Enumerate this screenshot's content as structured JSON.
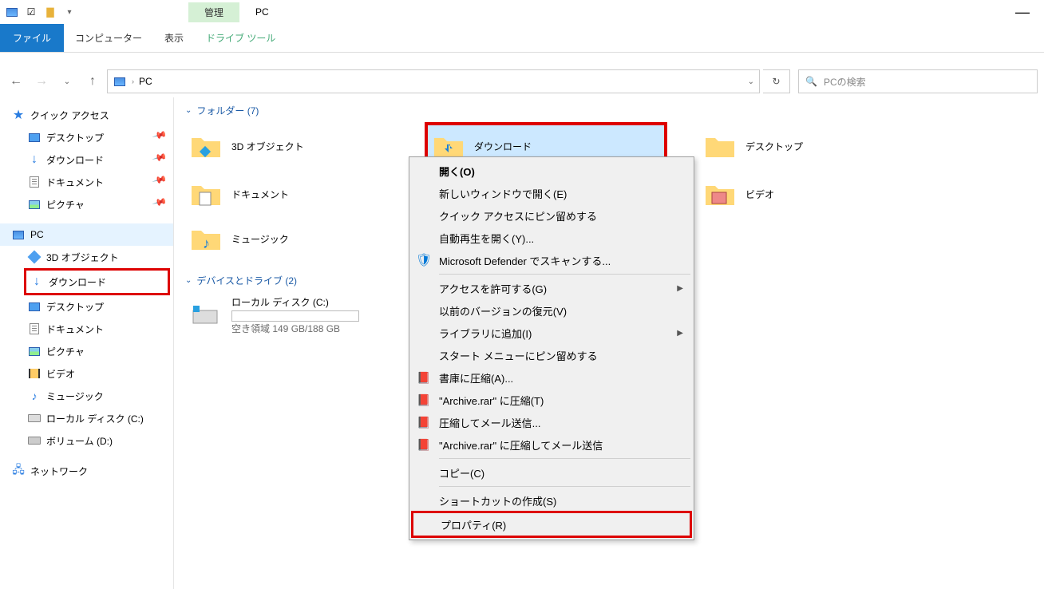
{
  "title": {
    "context_tab": "管理",
    "window_title": "PC"
  },
  "ribbon": {
    "file": "ファイル",
    "computer": "コンピューター",
    "view": "表示",
    "drive_tools": "ドライブ ツール"
  },
  "address": {
    "crumb1": "PC",
    "search_placeholder": "PCの検索"
  },
  "sidebar": {
    "quick_access": "クイック アクセス",
    "qa": {
      "desktop": "デスクトップ",
      "downloads": "ダウンロード",
      "documents": "ドキュメント",
      "pictures": "ピクチャ"
    },
    "pc": "PC",
    "pc_children": {
      "objects3d": "3D オブジェクト",
      "downloads": "ダウンロード",
      "desktop": "デスクトップ",
      "documents": "ドキュメント",
      "pictures": "ピクチャ",
      "videos": "ビデオ",
      "music": "ミュージック",
      "local_disk": "ローカル ディスク (C:)",
      "volume": "ボリューム (D:)"
    },
    "network": "ネットワーク"
  },
  "content": {
    "folders_header": "フォルダー (7)",
    "items": {
      "objects3d": "3D オブジェクト",
      "downloads": "ダウンロード",
      "desktop": "デスクトップ",
      "documents": "ドキュメント",
      "videos": "ビデオ",
      "music": "ミュージック"
    },
    "drives_header": "デバイスとドライブ (2)",
    "drive": {
      "name": "ローカル ディスク (C:)",
      "free": "空き領域 149 GB/188 GB"
    }
  },
  "context_menu": {
    "open": "開く(O)",
    "open_new_window": "新しいウィンドウで開く(E)",
    "pin_quick_access": "クイック アクセスにピン留めする",
    "autoplay": "自動再生を開く(Y)...",
    "defender": "Microsoft Defender でスキャンする...",
    "give_access": "アクセスを許可する(G)",
    "restore_previous": "以前のバージョンの復元(V)",
    "include_library": "ライブラリに追加(I)",
    "pin_start": "スタート メニューにピン留めする",
    "archive_a": "書庫に圧縮(A)...",
    "archive_rar": "\"Archive.rar\" に圧縮(T)",
    "compress_email": "圧縮してメール送信...",
    "archive_rar_email": "\"Archive.rar\" に圧縮してメール送信",
    "copy": "コピー(C)",
    "create_shortcut": "ショートカットの作成(S)",
    "properties": "プロパティ(R)"
  }
}
